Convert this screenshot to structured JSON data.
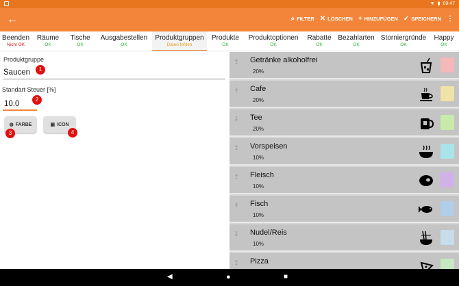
{
  "status": {
    "time": "09:47"
  },
  "toolbar": {
    "back_icon": "arrow-left-icon",
    "actions": [
      {
        "label": "FILTER",
        "icon": "search-icon"
      },
      {
        "label": "LÖSCHEN",
        "icon": "close-icon"
      },
      {
        "label": "HINZUFÜGEN",
        "icon": "plus-icon"
      },
      {
        "label": "SPEICHERN",
        "icon": "check-icon"
      }
    ]
  },
  "tabs": [
    {
      "label": "Beenden",
      "status": "Nicht OK",
      "state": "nok"
    },
    {
      "label": "Räume",
      "status": "OK",
      "state": "ok"
    },
    {
      "label": "Tische",
      "status": "OK",
      "state": "ok"
    },
    {
      "label": "Ausgabestellen",
      "status": "OK",
      "state": "ok"
    },
    {
      "label": "Produktgruppen",
      "status": "Daten fehlen",
      "state": "wait"
    },
    {
      "label": "Produkte",
      "status": "OK",
      "state": "ok"
    },
    {
      "label": "Produktoptionen",
      "status": "OK",
      "state": "ok"
    },
    {
      "label": "Rabatte",
      "status": "OK",
      "state": "ok"
    },
    {
      "label": "Bezahlarten",
      "status": "OK",
      "state": "ok"
    },
    {
      "label": "Storniergründe",
      "status": "OK",
      "state": "ok"
    },
    {
      "label": "Happy",
      "status": "OK",
      "state": "ok"
    }
  ],
  "form": {
    "group_label": "Produktgruppe",
    "group_value": "Saucen",
    "tax_label": "Standart Steuer [%]",
    "tax_value": "10.0",
    "color_button": "FARBE",
    "icon_button": "ICON",
    "badges": [
      "1",
      "2",
      "3",
      "4"
    ]
  },
  "groups": [
    {
      "name": "Getränke alkoholfrei",
      "tax": "20%",
      "icon": "soft-drink-icon",
      "color": "#f4b8b8"
    },
    {
      "name": "Cafe",
      "tax": "20%",
      "icon": "coffee-cup-icon",
      "color": "#efe3a8"
    },
    {
      "name": "Tee",
      "tax": "20%",
      "icon": "tea-mug-icon",
      "color": "#c9eaa8"
    },
    {
      "name": "Vorspeisen",
      "tax": "10%",
      "icon": "soup-bowl-icon",
      "color": "#a8e4ea"
    },
    {
      "name": "Fleisch",
      "tax": "10%",
      "icon": "steak-icon",
      "color": "#d2b0ea"
    },
    {
      "name": "Fisch",
      "tax": "10%",
      "icon": "fish-icon",
      "color": "#b0cdea"
    },
    {
      "name": "Nudel/Reis",
      "tax": "10%",
      "icon": "noodles-icon",
      "color": "#c8dcea"
    },
    {
      "name": "Pizza",
      "tax": "",
      "icon": "pizza-icon",
      "color": "#c8e8c0"
    }
  ]
}
